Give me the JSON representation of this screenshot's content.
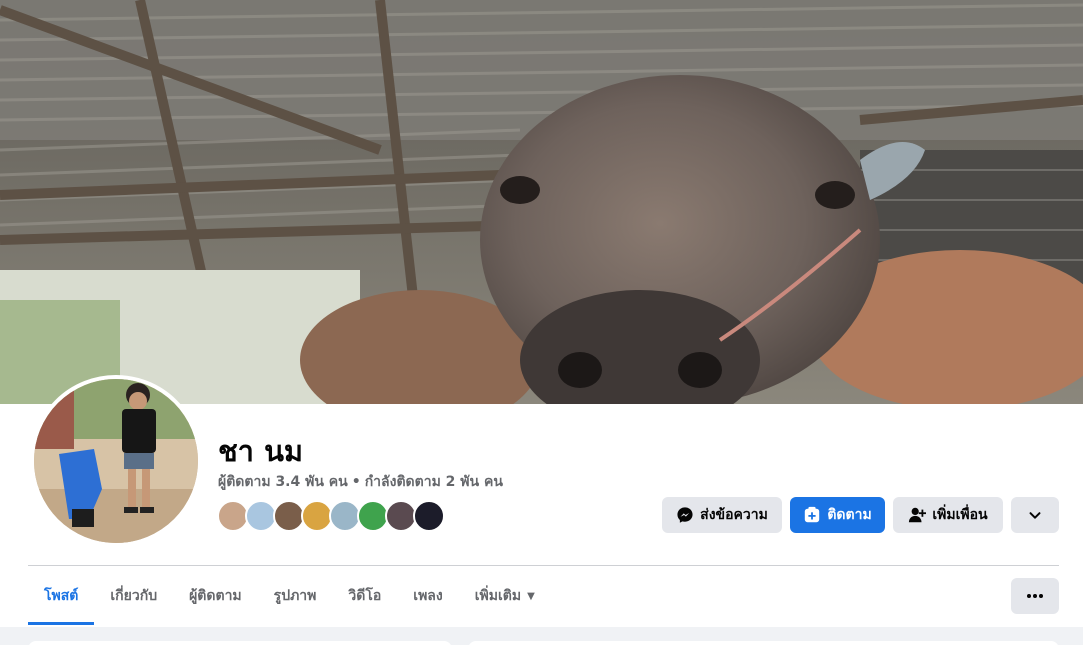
{
  "profile": {
    "name": "ชา นม",
    "followers": "ผู้ติดตาม 3.4 พัน คน",
    "separator": "•",
    "following": "กำลังติดตาม 2 พัน คน"
  },
  "actions": {
    "message_label": "ส่งข้อความ",
    "follow_label": "ติดตาม",
    "add_friend_label": "เพิ่มเพื่อน"
  },
  "tabs": [
    {
      "label": "โพสต์",
      "active": true
    },
    {
      "label": "เกี่ยวกับ"
    },
    {
      "label": "ผู้ติดตาม"
    },
    {
      "label": "รูปภาพ"
    },
    {
      "label": "วิดีโอ"
    },
    {
      "label": "เพลง"
    },
    {
      "label": "เพิ่มเติม"
    }
  ],
  "icons": {
    "message": "messenger-icon",
    "follow": "follow-plus-icon",
    "add_friend": "add-friend-icon",
    "dropdown": "chevron-down-icon",
    "more": "more-dots-icon"
  },
  "colors": {
    "accent": "#1b74e4",
    "text_primary": "#050505",
    "text_secondary": "#65676b",
    "button_gray": "#e4e6eb"
  },
  "friend_avatar_colors": [
    "#c9a58a",
    "#a9c6e0",
    "#7a5e4a",
    "#d9a441",
    "#9ab6c8",
    "#3fa34d",
    "#5a4a50",
    "#1c1c2a"
  ]
}
